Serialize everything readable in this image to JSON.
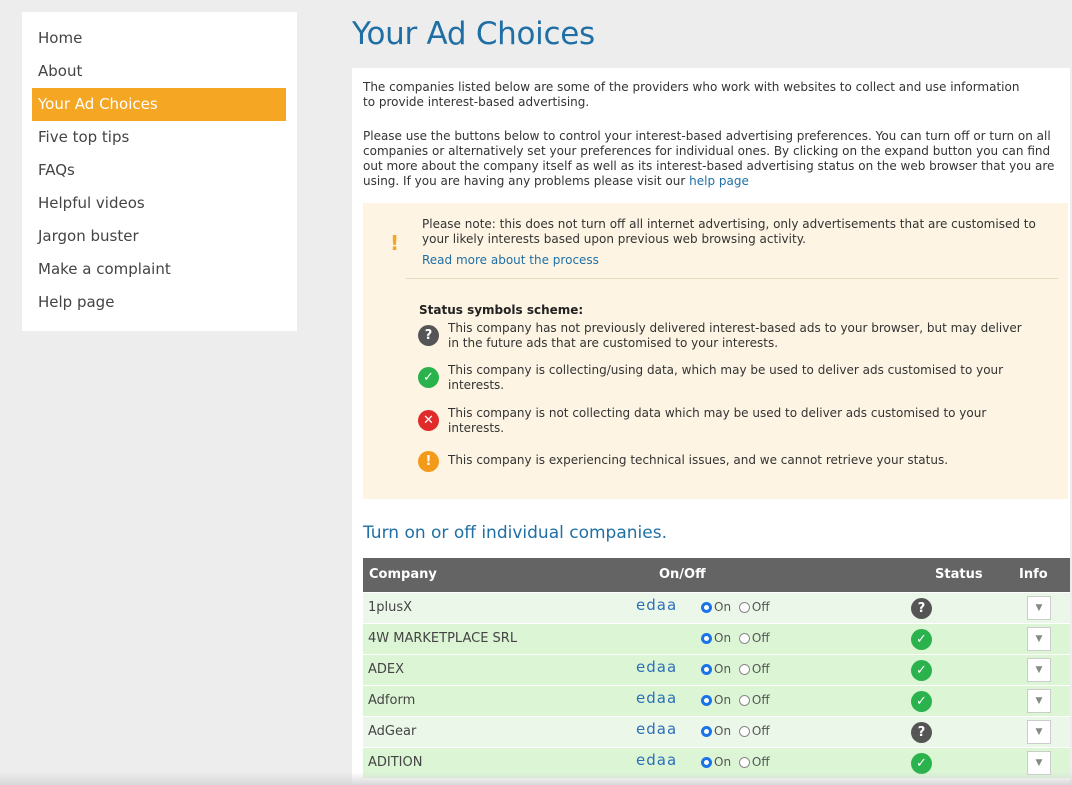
{
  "sidebar": {
    "items": [
      {
        "label": "Home",
        "active": false
      },
      {
        "label": "About",
        "active": false
      },
      {
        "label": "Your Ad Choices",
        "active": true
      },
      {
        "label": "Five top tips",
        "active": false
      },
      {
        "label": "FAQs",
        "active": false
      },
      {
        "label": "Helpful videos",
        "active": false
      },
      {
        "label": "Jargon buster",
        "active": false
      },
      {
        "label": "Make a complaint",
        "active": false
      },
      {
        "label": "Help page",
        "active": false
      }
    ]
  },
  "page": {
    "title": "Your Ad Choices"
  },
  "intro": {
    "paragraph1": "The companies listed below are some of the providers who work with websites to collect and use information to provide interest-based advertising.",
    "paragraph2": "Please use the buttons below to control your interest-based advertising preferences. You can turn off or turn on all companies or alternatively set your preferences for individual ones. By clicking on the expand button you can find out more about the company itself as well as its interest-based advertising status on the web browser that you are using. If you are having any problems please visit our",
    "help_link": "help page"
  },
  "note": {
    "icon": "!",
    "text": "Please note: this does not turn off all internet advertising, only advertisements that are customised to your likely interests based upon previous web browsing activity.",
    "link": "Read more about the process"
  },
  "status_scheme": {
    "heading": "Status symbols scheme:",
    "items": [
      {
        "icon": "question-icon",
        "glyph": "?",
        "text": "This company has not previously delivered interest-based ads to your browser, but may deliver in the future ads that are customised to your interests."
      },
      {
        "icon": "check-icon",
        "glyph": "✓",
        "text": "This company is collecting/using data, which may be used to deliver ads customised to your interests."
      },
      {
        "icon": "cross-icon",
        "glyph": "✕",
        "text": "This company is not collecting data which may be used to deliver ads customised to your interests."
      },
      {
        "icon": "warning-icon",
        "glyph": "!",
        "text": "This company is experiencing technical issues, and we cannot retrieve your status."
      }
    ]
  },
  "companies_section": {
    "heading": "Turn on or off individual companies.",
    "columns": {
      "company": "Company",
      "on_off": "On/Off",
      "status": "Status",
      "info": "Info"
    },
    "on_label": "On",
    "off_label": "Off",
    "badge_text": "edaa",
    "rows": [
      {
        "name": "1plusX",
        "edaa": true,
        "on": true,
        "status": "question",
        "glyph": "?"
      },
      {
        "name": "4W MARKETPLACE SRL",
        "edaa": false,
        "on": true,
        "status": "active",
        "glyph": "✓"
      },
      {
        "name": "ADEX",
        "edaa": true,
        "on": true,
        "status": "active",
        "glyph": "✓"
      },
      {
        "name": "Adform",
        "edaa": true,
        "on": true,
        "status": "active",
        "glyph": "✓"
      },
      {
        "name": "AdGear",
        "edaa": true,
        "on": true,
        "status": "question",
        "glyph": "?"
      },
      {
        "name": "ADITION",
        "edaa": true,
        "on": true,
        "status": "active",
        "glyph": "✓"
      }
    ]
  },
  "colors": {
    "accent": "#f5a623",
    "link": "#1f6fa5",
    "row_green": "#dbf5d5",
    "row_green_alt": "#ebf7e8",
    "table_header": "#646464"
  }
}
